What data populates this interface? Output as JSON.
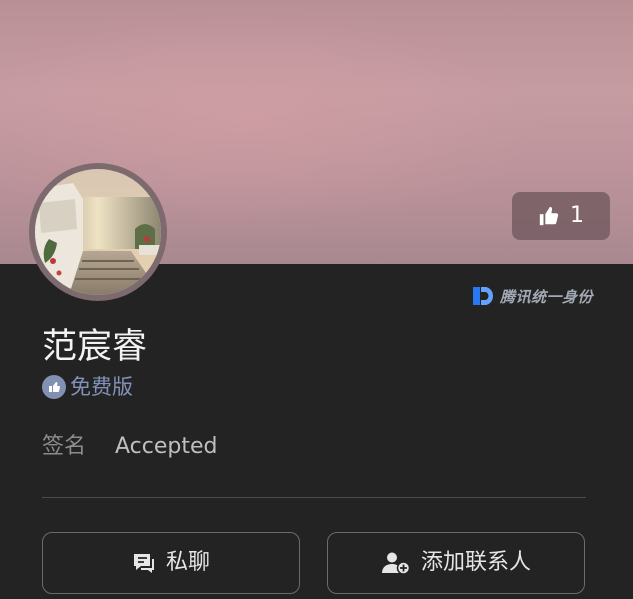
{
  "profile": {
    "name": "范宸睿",
    "plan_label": "免费版",
    "signature_label": "签名",
    "signature_value": "Accepted"
  },
  "likes": {
    "count": "1"
  },
  "badge": {
    "text": "腾讯统一身份"
  },
  "actions": {
    "chat_label": "私聊",
    "add_contact_label": "添加联系人"
  },
  "colors": {
    "background": "#232323",
    "cover": "#c29aa0",
    "plan_accent": "#8292b8",
    "text_primary": "#f2f2f2",
    "text_muted": "#8c8c8c"
  },
  "icons": {
    "like": "thumbs-up-icon",
    "plan": "plan-badge-icon",
    "tencent": "tencent-id-logo",
    "chat": "chat-icon",
    "add_contact": "add-contact-icon"
  }
}
